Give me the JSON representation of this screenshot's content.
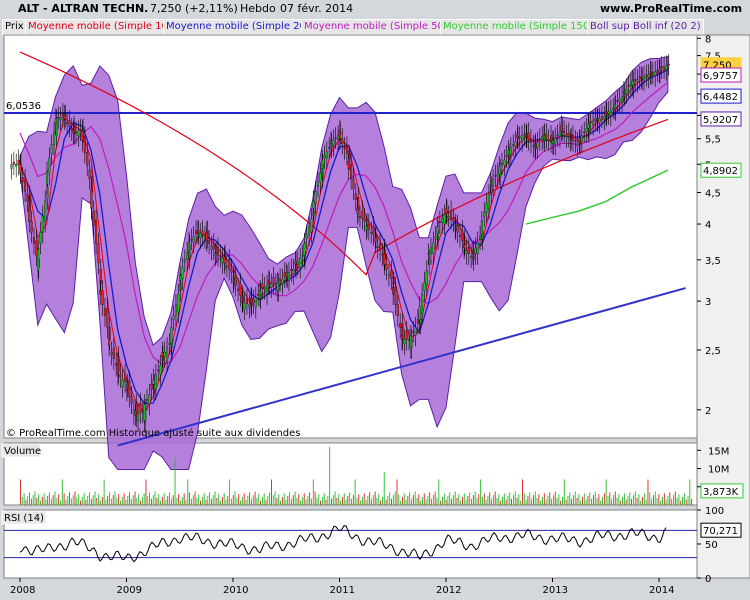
{
  "header": {
    "symbol": "ALT - ALTRAN TECHN.",
    "quote": "7,250 (+2,11%)",
    "period": "Hebdo",
    "date": "07 févr. 2014",
    "site": "www.ProRealTime.com"
  },
  "legend": [
    {
      "label": "Prix",
      "color": "#000000"
    },
    {
      "label": "Moyenne mobile (Simple 10)",
      "color": "#e0001a"
    },
    {
      "label": "Moyenne mobile (Simple 20)",
      "color": "#1a1acc"
    },
    {
      "label": "Moyenne mobile (Simple 50)",
      "color": "#c01cc0"
    },
    {
      "label": "Moyenne mobile (Simple 150)",
      "color": "#33cc33"
    },
    {
      "label": "Boll sup",
      "color": "#5c1fa6"
    },
    {
      "label": "Boll inf (20 2)",
      "color": "#5c1fa6"
    }
  ],
  "watermark": "© ProRealTime.com  Historique ajusté suite aux dividendes",
  "volume_label": "Volume",
  "rsi_label": "RSI (14)",
  "chart_data": [
    {
      "type": "candlestick",
      "panel": "price",
      "x_ticks": [
        "2008",
        "2009",
        "2010",
        "2011",
        "2012",
        "2013",
        "2014"
      ],
      "y_ticks": [
        "2",
        "2,5",
        "3",
        "3,5",
        "4",
        "4,5",
        "5",
        "5,5",
        "6",
        "6,5",
        "7",
        "7,5",
        "8"
      ],
      "ylim": [
        1.8,
        8.1
      ],
      "y_scale": "log",
      "horizontal_line": {
        "label": "6,0536",
        "value": 6.0536,
        "color": "#2222cc"
      },
      "trend_line": {
        "from": [
          "2008-12",
          1.75
        ],
        "to": [
          "2014-04",
          3.15
        ],
        "color": "#3333cc"
      },
      "last_values": [
        {
          "label": "7,250",
          "value": 7.25,
          "color": "#ffd040"
        },
        {
          "label": "6,9757",
          "value": 6.9757,
          "color": "#c01cc0"
        },
        {
          "label": "6,4482",
          "value": 6.4482,
          "color": "#1a1acc"
        },
        {
          "label": "5,9207",
          "value": 5.9207,
          "color": "#5c1fa6"
        },
        {
          "label": "4,8902",
          "value": 4.8902,
          "color": "#33cc33"
        }
      ],
      "series": [
        {
          "name": "Prix",
          "kind": "price",
          "x": [
            "2008-01",
            "2008-02",
            "2008-03",
            "2008-04",
            "2008-05",
            "2008-06",
            "2008-07",
            "2008-08",
            "2008-09",
            "2008-10",
            "2008-11",
            "2008-12",
            "2009-01",
            "2009-02",
            "2009-03",
            "2009-04",
            "2009-05",
            "2009-06",
            "2009-07",
            "2009-08",
            "2009-09",
            "2009-10",
            "2009-11",
            "2009-12",
            "2010-01",
            "2010-02",
            "2010-03",
            "2010-04",
            "2010-05",
            "2010-06",
            "2010-07",
            "2010-08",
            "2010-09",
            "2010-10",
            "2010-11",
            "2010-12",
            "2011-01",
            "2011-02",
            "2011-03",
            "2011-04",
            "2011-05",
            "2011-06",
            "2011-07",
            "2011-08",
            "2011-09",
            "2011-10",
            "2011-11",
            "2011-12",
            "2012-01",
            "2012-02",
            "2012-03",
            "2012-04",
            "2012-05",
            "2012-06",
            "2012-07",
            "2012-08",
            "2012-09",
            "2012-10",
            "2012-11",
            "2012-12",
            "2013-01",
            "2013-02",
            "2013-03",
            "2013-04",
            "2013-05",
            "2013-06",
            "2013-07",
            "2013-08",
            "2013-09",
            "2013-10",
            "2013-11",
            "2013-12",
            "2014-01",
            "2014-02"
          ],
          "values": [
            5.0,
            4.2,
            3.4,
            4.6,
            5.9,
            6.0,
            5.6,
            5.7,
            4.5,
            3.2,
            2.6,
            2.3,
            2.2,
            1.95,
            2.0,
            2.2,
            2.4,
            2.6,
            3.2,
            3.7,
            3.9,
            3.8,
            3.6,
            3.5,
            3.3,
            3.0,
            2.95,
            3.1,
            3.2,
            3.2,
            3.3,
            3.4,
            3.6,
            4.2,
            5.0,
            5.4,
            5.6,
            5.1,
            4.2,
            4.0,
            3.8,
            3.5,
            3.2,
            2.6,
            2.6,
            2.8,
            3.5,
            3.9,
            4.2,
            4.0,
            3.7,
            3.5,
            3.9,
            4.6,
            4.9,
            5.2,
            5.5,
            5.6,
            5.3,
            5.6,
            5.4,
            5.7,
            5.5,
            5.4,
            5.8,
            5.9,
            6.0,
            6.2,
            6.5,
            6.8,
            6.9,
            7.0,
            7.1,
            7.25
          ]
        },
        {
          "name": "Moyenne mobile (Simple 150)",
          "color": "#33cc33",
          "x": [
            "2012-10",
            "2013-01",
            "2013-04",
            "2013-07",
            "2013-10",
            "2014-02"
          ],
          "values": [
            4.0,
            4.1,
            4.2,
            4.35,
            4.6,
            4.89
          ]
        }
      ]
    },
    {
      "type": "bar",
      "panel": "volume",
      "y_ticks": [
        "5M",
        "10M",
        "15M"
      ],
      "ylim": [
        0,
        17000000
      ],
      "last_value": {
        "label": "3,873K",
        "value": 3873000,
        "color": "#33cc33"
      }
    },
    {
      "type": "line",
      "panel": "rsi",
      "y_ticks": [
        "0",
        "50",
        "100"
      ],
      "ylim": [
        0,
        100
      ],
      "last_value": {
        "label": "70,271",
        "value": 70.271
      },
      "x": [
        "2008-01",
        "2008-04",
        "2008-07",
        "2008-10",
        "2009-01",
        "2009-04",
        "2009-07",
        "2009-10",
        "2010-01",
        "2010-04",
        "2010-07",
        "2010-10",
        "2011-01",
        "2011-04",
        "2011-07",
        "2011-10",
        "2012-01",
        "2012-04",
        "2012-07",
        "2012-10",
        "2013-01",
        "2013-04",
        "2013-07",
        "2013-10",
        "2014-01",
        "2014-02"
      ],
      "values": [
        45,
        40,
        55,
        35,
        28,
        45,
        60,
        55,
        48,
        42,
        50,
        58,
        72,
        55,
        45,
        30,
        55,
        48,
        60,
        62,
        58,
        55,
        62,
        65,
        60,
        70.271
      ]
    }
  ]
}
